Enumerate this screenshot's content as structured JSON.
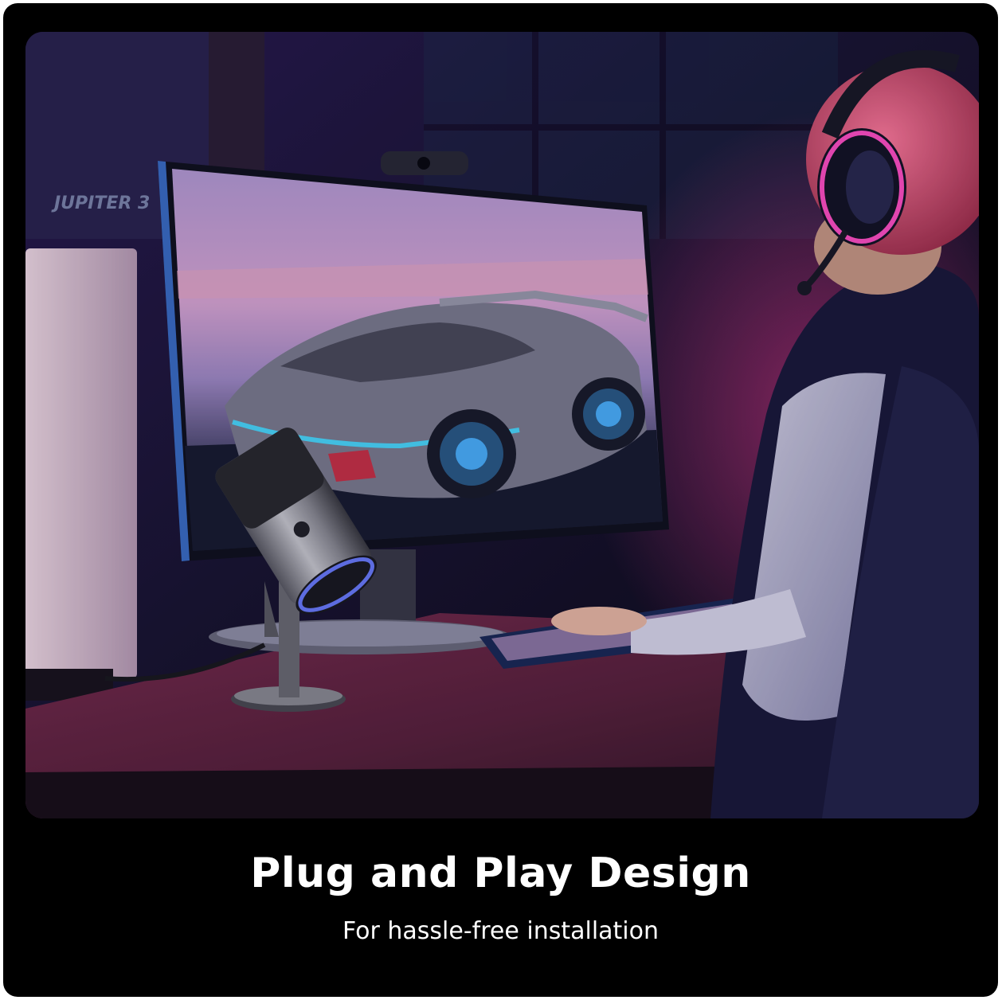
{
  "headline": "Plug and Play Design",
  "subline": "For hassle-free installation",
  "wall_poster_text": "JUPITER 3",
  "colors": {
    "background": "#000000",
    "text": "#ffffff",
    "ambient_purple": "#3a1f6e",
    "neon_pink": "#ff3fa0",
    "neon_blue": "#4aa8ff",
    "desk": "#5a2440"
  }
}
